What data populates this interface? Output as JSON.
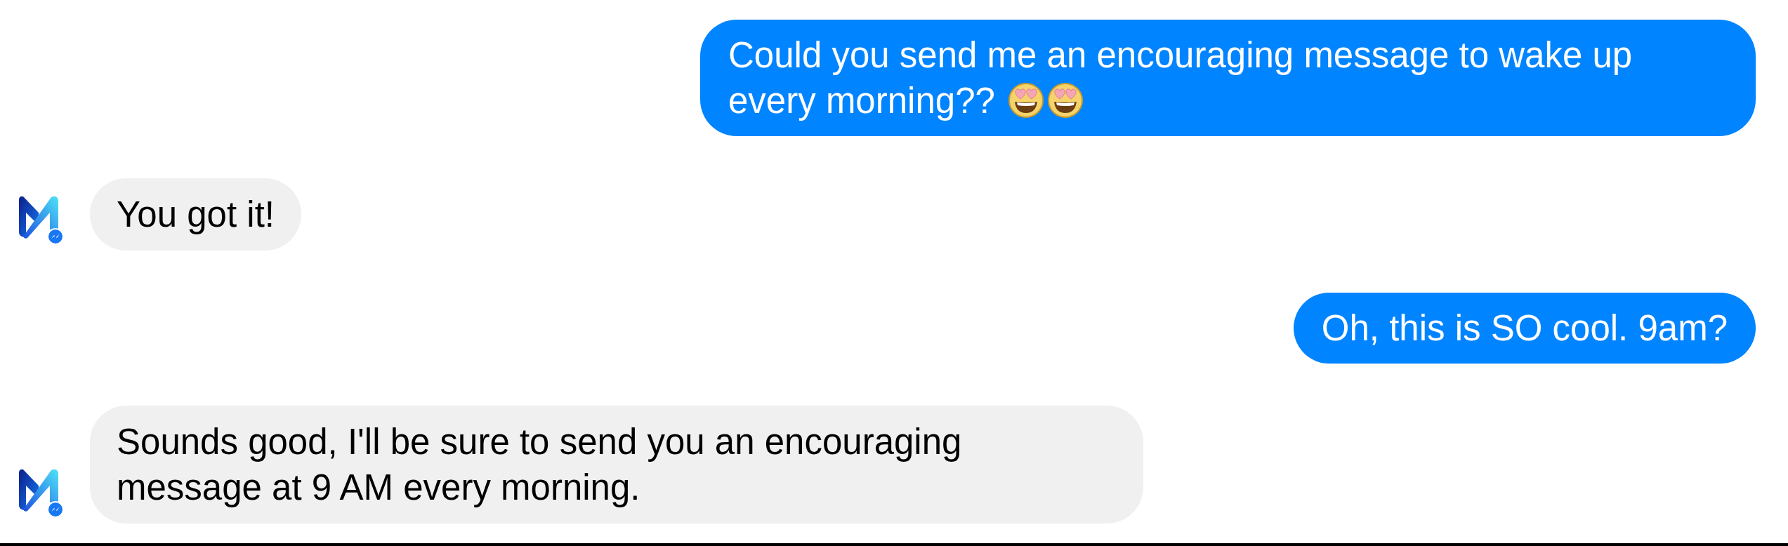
{
  "messages": [
    {
      "kind": "sent",
      "text": "Could you send me an encouraging message to wake up every morning??",
      "emoji": [
        {
          "kind": "heart-eyes"
        },
        {
          "kind": "heart-eyes"
        }
      ]
    },
    {
      "kind": "received",
      "text": "You got it!"
    },
    {
      "kind": "sent",
      "text": "Oh, this is SO cool. 9am?"
    },
    {
      "kind": "received",
      "text": "Sounds good, I'll be sure to send you an encouraging message at 9 AM every morning."
    }
  ]
}
